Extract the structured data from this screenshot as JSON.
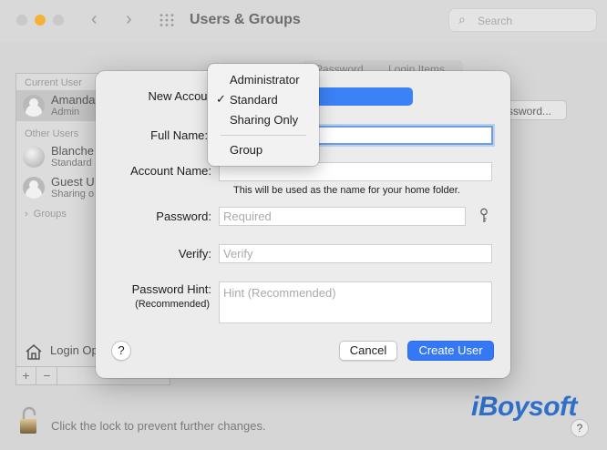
{
  "window": {
    "title": "Users & Groups",
    "search_placeholder": "Search",
    "tabs": [
      "Password",
      "Login Items"
    ],
    "password_button": "ssword...",
    "lock_text": "Click the lock to prevent further changes.",
    "brand": "iBoysoft",
    "help": "?"
  },
  "sidebar": {
    "current_user_header": "Current User",
    "current_user": {
      "name": "Amanda",
      "role": "Admin"
    },
    "other_users_header": "Other Users",
    "other_users": [
      {
        "name": "Blanche",
        "role": "Standard"
      },
      {
        "name": "Guest U",
        "role": "Sharing o"
      }
    ],
    "groups_label": "Groups",
    "login_options": "Login Op",
    "add": "+",
    "remove": "−"
  },
  "dialog": {
    "new_account_label": "New Account:",
    "full_name_label": "Full Name:",
    "account_name_label": "Account Name:",
    "account_name_note": "This will be used as the name for your home folder.",
    "password_label": "Password:",
    "password_placeholder": "Required",
    "verify_label": "Verify:",
    "verify_placeholder": "Verify",
    "hint_label": "Password Hint:",
    "hint_sublabel": "(Recommended)",
    "hint_placeholder": "Hint (Recommended)",
    "help": "?",
    "cancel": "Cancel",
    "create_user": "Create User"
  },
  "account_menu": {
    "items": [
      {
        "label": "Administrator",
        "checked": false
      },
      {
        "label": "Standard",
        "checked": true
      },
      {
        "label": "Sharing Only",
        "checked": false
      },
      {
        "label": "Group",
        "checked": false
      }
    ],
    "checkmark": "✓"
  },
  "colors": {
    "accent": "#3478f6",
    "brand": "#2e6fc9",
    "traffic_yellow": "#f3b33a"
  }
}
